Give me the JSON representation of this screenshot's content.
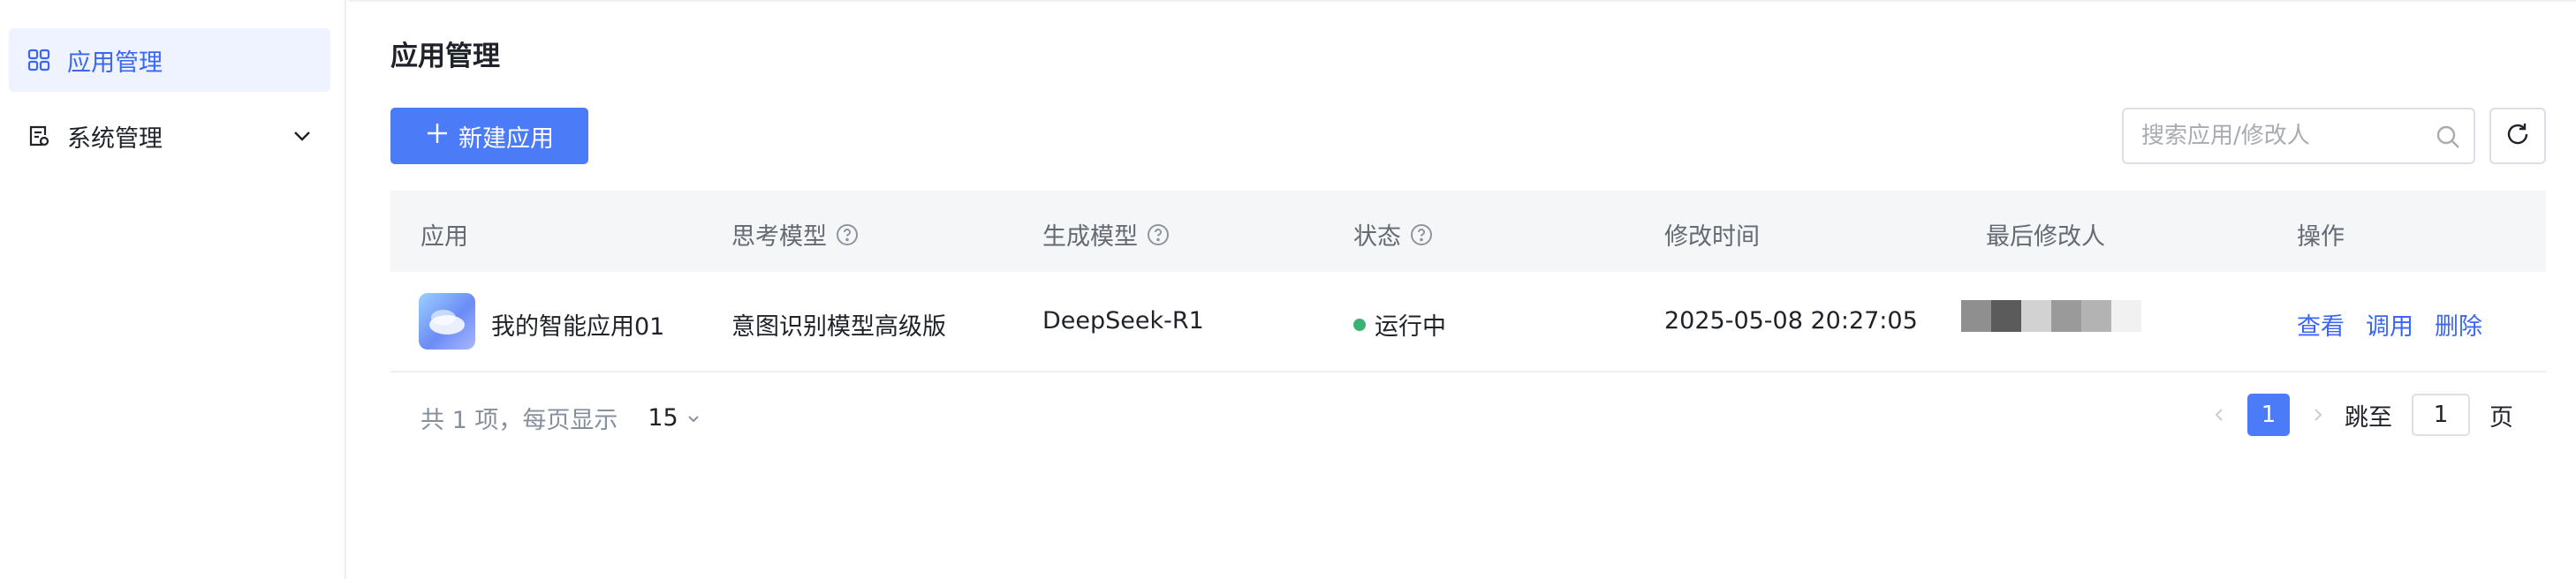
{
  "sidebar": {
    "items": [
      {
        "label": "应用管理",
        "icon": "grid-icon",
        "active": true
      },
      {
        "label": "系统管理",
        "icon": "system-doc-icon",
        "expandable": true
      }
    ]
  },
  "main": {
    "title": "应用管理",
    "new_button_label": "新建应用",
    "search_placeholder": "搜索应用/修改人"
  },
  "table": {
    "columns": [
      "应用",
      "思考模型",
      "生成模型",
      "状态",
      "修改时间",
      "最后修改人",
      "操作"
    ],
    "rows": [
      {
        "app": "我的智能应用01",
        "thinking_model": "意图识别模型高级版",
        "generation_model": "DeepSeek-R1",
        "status": "运行中",
        "modified_time": "2025-05-08 20:27:05",
        "actions": [
          "查看",
          "调用",
          "删除"
        ]
      }
    ]
  },
  "pagination": {
    "summary": "共 1 项，每页显示",
    "page_size": "15",
    "current_page": "1",
    "jump_label": "跳至",
    "jump_value": "1",
    "page_unit": "页"
  },
  "colors": {
    "accent": "#4c7bf7",
    "status_running": "#3bb273",
    "link": "#3a66f5"
  }
}
